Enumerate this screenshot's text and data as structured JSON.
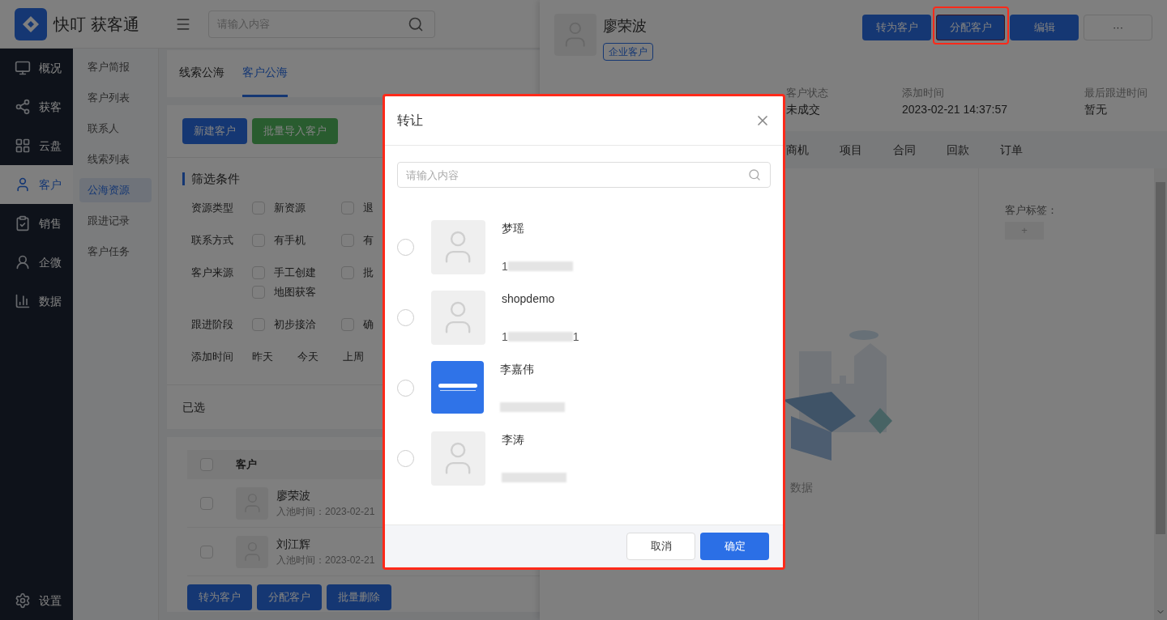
{
  "app": {
    "name": "快叮 获客通"
  },
  "header_search": {
    "placeholder": "请输入内容"
  },
  "nav": [
    {
      "label": "概况",
      "selected": false
    },
    {
      "label": "获客",
      "selected": false
    },
    {
      "label": "云盘",
      "selected": false
    },
    {
      "label": "客户",
      "selected": true
    },
    {
      "label": "销售",
      "selected": false
    },
    {
      "label": "企微",
      "selected": false
    },
    {
      "label": "数据",
      "selected": false
    }
  ],
  "settings": {
    "label": "设置"
  },
  "sub_nav": [
    {
      "label": "客户简报",
      "selected": false
    },
    {
      "label": "客户列表",
      "selected": false
    },
    {
      "label": "联系人",
      "selected": false
    },
    {
      "label": "线索列表",
      "selected": false
    },
    {
      "label": "公海资源",
      "selected": true
    },
    {
      "label": "跟进记录",
      "selected": false
    },
    {
      "label": "客户任务",
      "selected": false
    }
  ],
  "tabs": [
    {
      "label": "线索公海",
      "selected": false
    },
    {
      "label": "客户公海",
      "selected": true
    }
  ],
  "toolbar_buttons": [
    {
      "label": "新建客户",
      "kind": "primary"
    },
    {
      "label": "批量导入客户",
      "kind": "success"
    }
  ],
  "filter_title": "筛选条件",
  "filters": [
    {
      "label": "资源类型",
      "options": [
        {
          "label": "新资源",
          "checked": false
        },
        {
          "label": "退",
          "checked": false
        }
      ]
    },
    {
      "label": "联系方式",
      "options": [
        {
          "label": "有手机",
          "checked": false
        },
        {
          "label": "有",
          "checked": false
        }
      ]
    },
    {
      "label": "客户来源",
      "options": [
        {
          "label": "手工创建",
          "checked": false
        },
        {
          "label": "批",
          "checked": false
        },
        {
          "label": "地图获客",
          "checked": false
        }
      ]
    },
    {
      "label": "跟进阶段",
      "options": [
        {
          "label": "初步接洽",
          "checked": false
        },
        {
          "label": "确",
          "checked": false
        }
      ]
    }
  ],
  "time_filter": {
    "label": "添加时间",
    "options": [
      "昨天",
      "今天",
      "上周"
    ]
  },
  "selected_label": "已选",
  "table": {
    "header_checked": false,
    "columns": [
      "客户"
    ],
    "rows": [
      {
        "name": "廖荣波",
        "meta": "入池时间：2023-02-21",
        "checked": false
      },
      {
        "name": "刘江辉",
        "meta": "入池时间：2023-02-21",
        "checked": false
      }
    ]
  },
  "bulk_buttons": [
    "转为客户",
    "分配客户",
    "批量删除"
  ],
  "drawer": {
    "name": "廖荣波",
    "tag": "企业客户",
    "actions": [
      {
        "label": "转为客户",
        "kind": "primary",
        "highlighted": false
      },
      {
        "label": "分配客户",
        "kind": "primary",
        "highlighted": true
      },
      {
        "label": "编辑",
        "kind": "primary",
        "highlighted": false
      },
      {
        "label": "···",
        "kind": "more",
        "highlighted": false
      }
    ],
    "fields": [
      {
        "label": "客户状态",
        "value": "未成交"
      },
      {
        "label": "添加时间",
        "value": "2023-02-21 14:37:57"
      },
      {
        "label": "最后跟进时间",
        "value": "暂无"
      }
    ],
    "tabs": [
      {
        "label": "商机",
        "selected": false
      },
      {
        "label": "项目",
        "selected": false
      },
      {
        "label": "合同",
        "selected": false
      },
      {
        "label": "回款",
        "selected": false
      },
      {
        "label": "订单",
        "selected": false
      }
    ],
    "empty_text": "数据",
    "tag_label": "客户标签：",
    "add_tag": "+"
  },
  "dialog": {
    "title": "转让",
    "search": {
      "placeholder": "请输入内容"
    },
    "users": [
      {
        "name": "梦瑶",
        "kind": "default",
        "phone_prefix": "1",
        "selected": false
      },
      {
        "name": "shopdemo",
        "kind": "default",
        "phone_prefix": "1",
        "phone_suffix": "1",
        "selected": false
      },
      {
        "name": "李嘉伟",
        "kind": "logo",
        "selected": false
      },
      {
        "name": "李涛",
        "kind": "default",
        "selected": false
      }
    ],
    "buttons": [
      {
        "label": "取消",
        "kind": "default"
      },
      {
        "label": "确定",
        "kind": "primary"
      }
    ]
  }
}
